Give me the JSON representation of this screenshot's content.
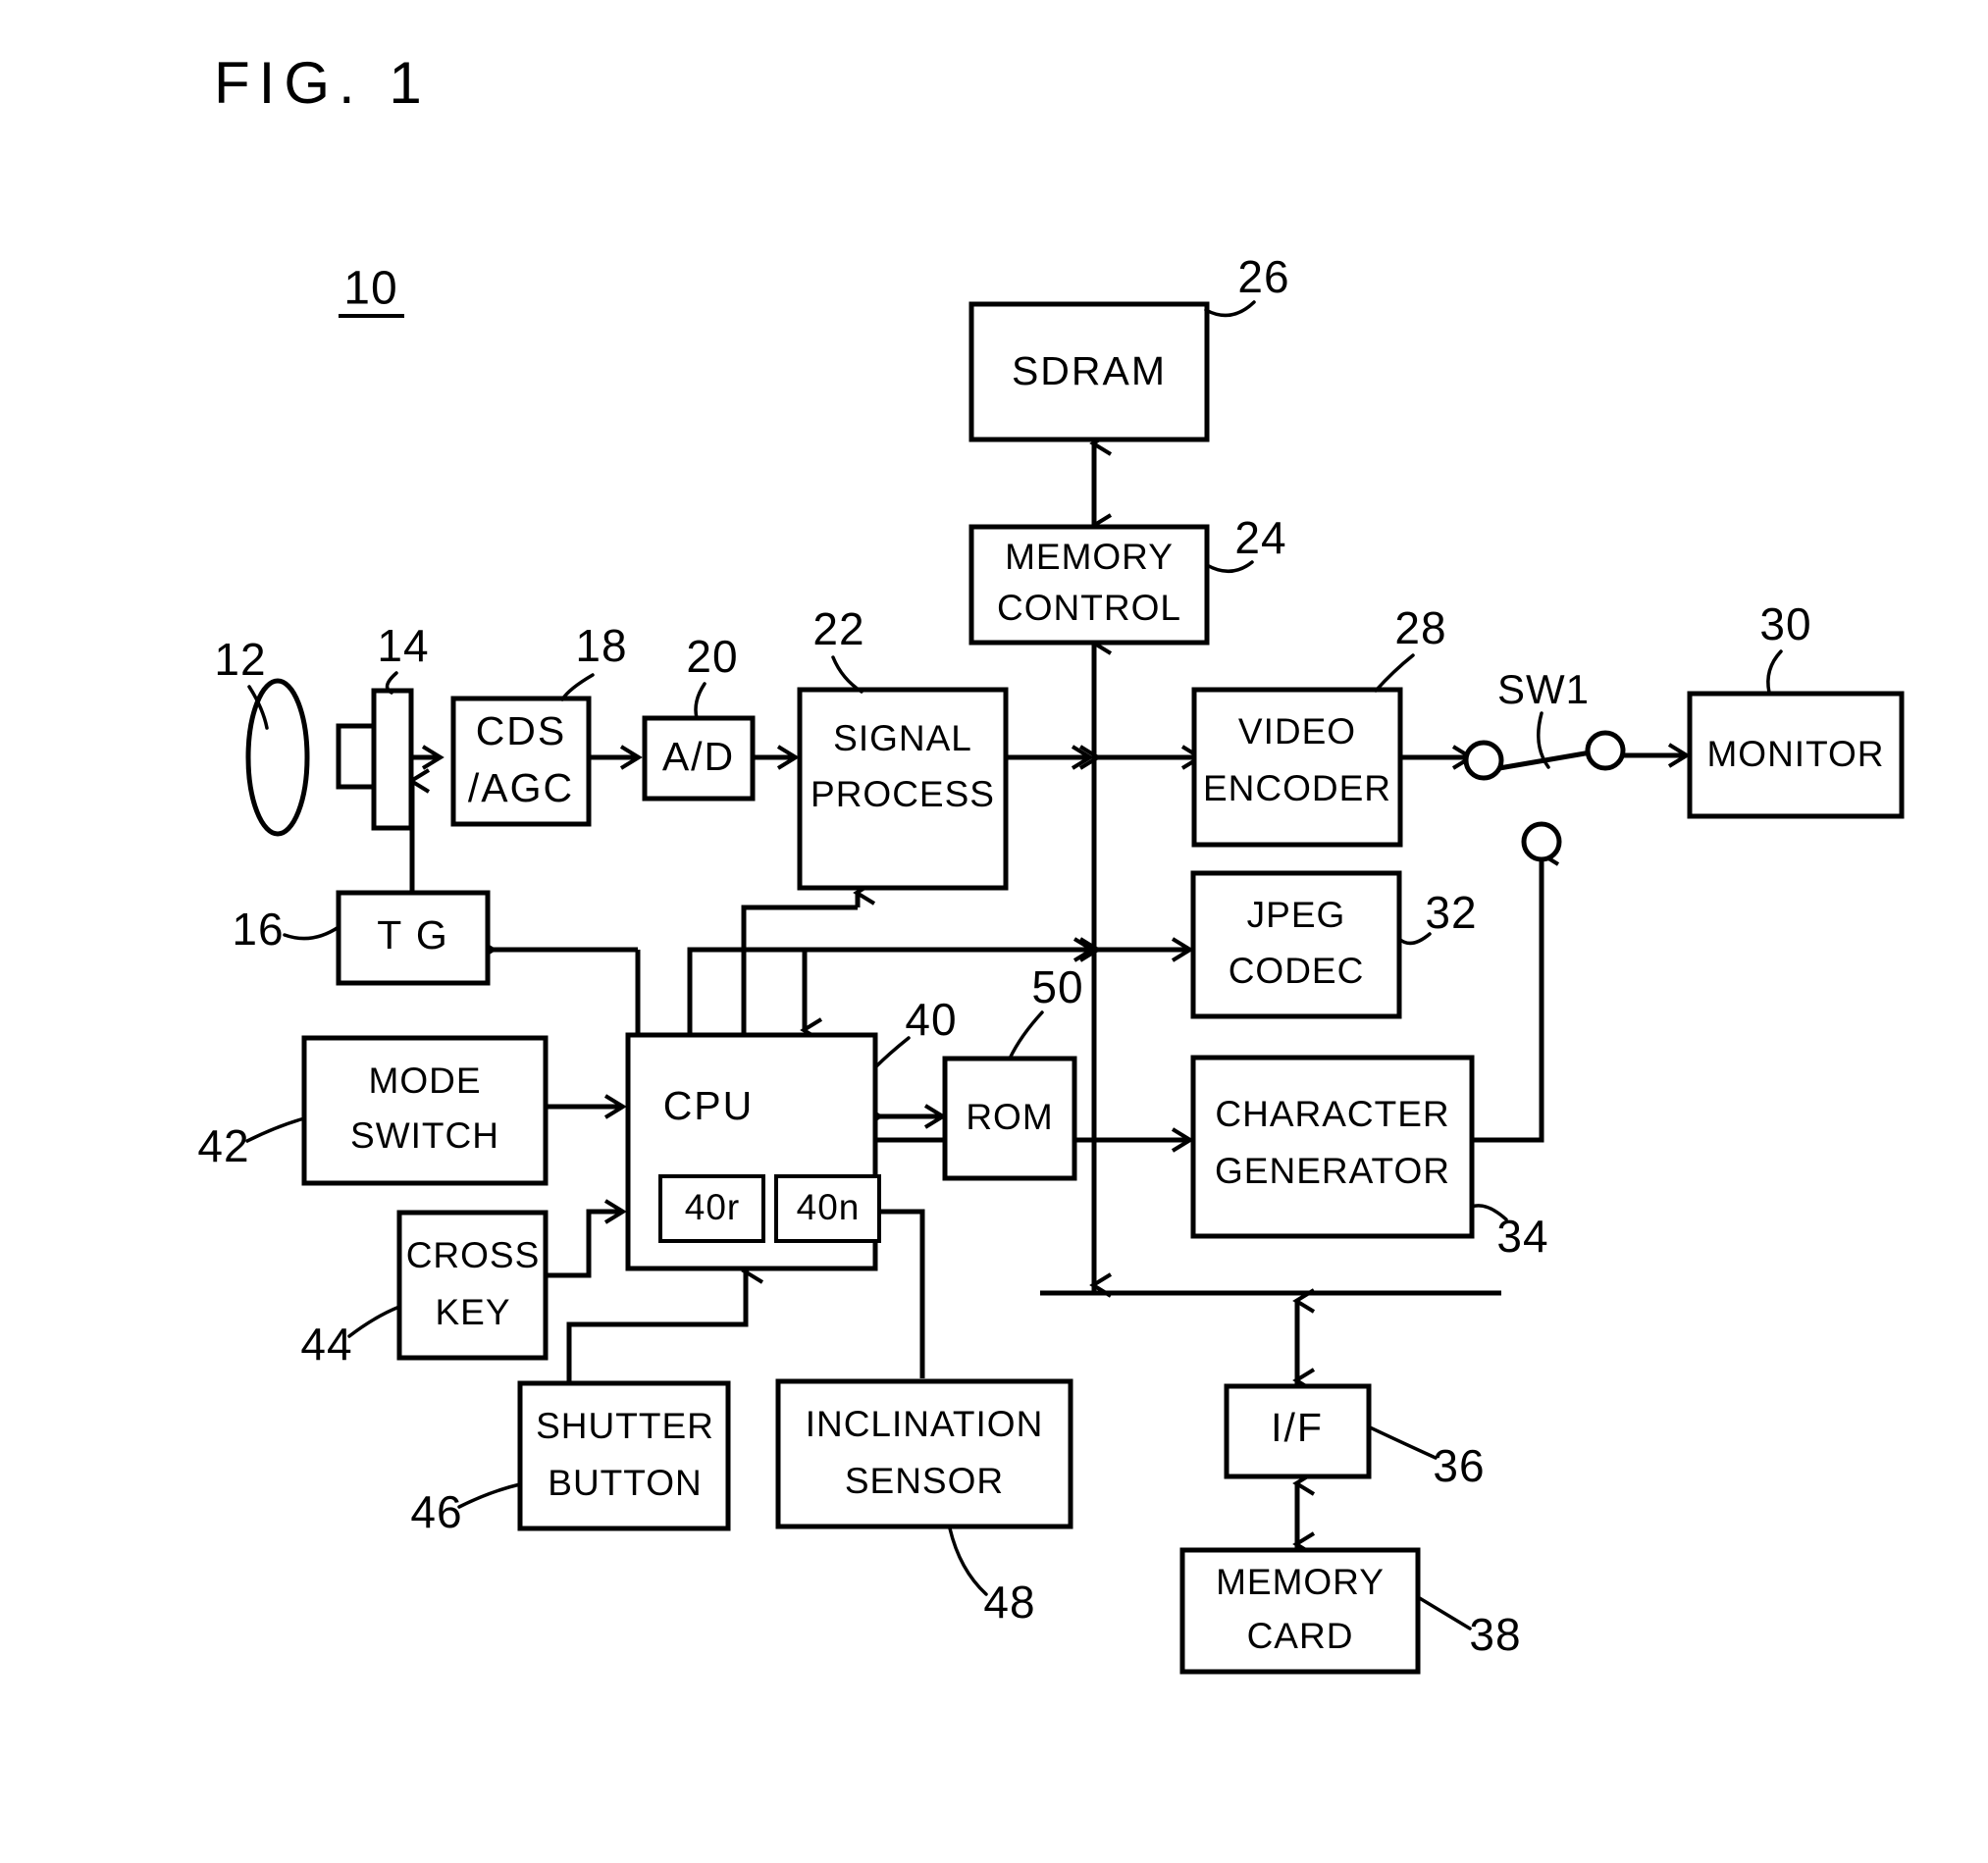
{
  "figure": {
    "title": "FIG.  1",
    "system_number": "10"
  },
  "blocks": [
    {
      "id": "lens",
      "label_lines": [
        "LENS"
      ],
      "ref": "12",
      "shape": "ellipse"
    },
    {
      "id": "imager",
      "label_lines": [],
      "ref": "14",
      "shape": "sensor"
    },
    {
      "id": "tg",
      "label_lines": [
        "T G"
      ],
      "ref": "16",
      "shape": "rect"
    },
    {
      "id": "cds_agc",
      "label_lines": [
        "CDS",
        "/AGC"
      ],
      "ref": "18",
      "shape": "rect"
    },
    {
      "id": "ad",
      "label_lines": [
        "A/D"
      ],
      "ref": "20",
      "shape": "rect"
    },
    {
      "id": "signal",
      "label_lines": [
        "SIGNAL",
        "PROCESS"
      ],
      "ref": "22",
      "shape": "rect"
    },
    {
      "id": "memctl",
      "label_lines": [
        "MEMORY",
        "CONTROL"
      ],
      "ref": "24",
      "shape": "rect"
    },
    {
      "id": "sdram",
      "label_lines": [
        "SDRAM"
      ],
      "ref": "26",
      "shape": "rect"
    },
    {
      "id": "vencoder",
      "label_lines": [
        "VIDEO",
        "ENCODER"
      ],
      "ref": "28",
      "shape": "rect"
    },
    {
      "id": "monitor",
      "label_lines": [
        "MONITOR"
      ],
      "ref": "30",
      "shape": "rect"
    },
    {
      "id": "jpeg",
      "label_lines": [
        "JPEG",
        "CODEC"
      ],
      "ref": "32",
      "shape": "rect"
    },
    {
      "id": "chargen",
      "label_lines": [
        "CHARACTER",
        "GENERATOR"
      ],
      "ref": "34",
      "shape": "rect"
    },
    {
      "id": "if",
      "label_lines": [
        "I/F"
      ],
      "ref": "36",
      "shape": "rect"
    },
    {
      "id": "memcard",
      "label_lines": [
        "MEMORY",
        "CARD"
      ],
      "ref": "38",
      "shape": "rect"
    },
    {
      "id": "cpu",
      "label_lines": [
        "CPU"
      ],
      "ref": "40",
      "shape": "rect"
    },
    {
      "id": "cpu_reg_r",
      "label_lines": [
        "40r"
      ],
      "ref": "",
      "shape": "rect"
    },
    {
      "id": "cpu_reg_n",
      "label_lines": [
        "40n"
      ],
      "ref": "",
      "shape": "rect"
    },
    {
      "id": "modesw",
      "label_lines": [
        "MODE",
        "SWITCH"
      ],
      "ref": "42",
      "shape": "rect"
    },
    {
      "id": "crosskey",
      "label_lines": [
        "CROSS",
        "KEY"
      ],
      "ref": "44",
      "shape": "rect"
    },
    {
      "id": "shutter",
      "label_lines": [
        "SHUTTER",
        "BUTTON"
      ],
      "ref": "46",
      "shape": "rect"
    },
    {
      "id": "inclin",
      "label_lines": [
        "INCLINATION",
        "SENSOR"
      ],
      "ref": "48",
      "shape": "rect"
    },
    {
      "id": "rom",
      "label_lines": [
        "ROM"
      ],
      "ref": "50",
      "shape": "rect"
    }
  ],
  "labels": {
    "sdram": "SDRAM",
    "memory_control_l1": "MEMORY",
    "memory_control_l2": "CONTROL",
    "cds_l1": "CDS",
    "cds_l2": "/AGC",
    "ad": "A/D",
    "signal_l1": "SIGNAL",
    "signal_l2": "PROCESS",
    "video_l1": "VIDEO",
    "video_l2": "ENCODER",
    "monitor": "MONITOR",
    "jpeg_l1": "JPEG",
    "jpeg_l2": "CODEC",
    "chargen_l1": "CHARACTER",
    "chargen_l2": "GENERATOR",
    "iface": "I/F",
    "memcard_l1": "MEMORY",
    "memcard_l2": "CARD",
    "tg": "T G",
    "cpu": "CPU",
    "cpu_reg_r": "40r",
    "cpu_reg_n": "40n",
    "rom": "ROM",
    "mode_l1": "MODE",
    "mode_l2": "SWITCH",
    "cross_l1": "CROSS",
    "cross_l2": "KEY",
    "shutter_l1": "SHUTTER",
    "shutter_l2": "BUTTON",
    "inclin_l1": "INCLINATION",
    "inclin_l2": "SENSOR",
    "sw1": "SW1"
  },
  "refs": {
    "r10": "10",
    "r12": "12",
    "r14": "14",
    "r16": "16",
    "r18": "18",
    "r20": "20",
    "r22": "22",
    "r24": "24",
    "r26": "26",
    "r28": "28",
    "r30": "30",
    "r32": "32",
    "r34": "34",
    "r36": "36",
    "r38": "38",
    "r40": "40",
    "r42": "42",
    "r44": "44",
    "r46": "46",
    "r48": "48",
    "r50": "50"
  },
  "colors": {
    "ink": "#000000",
    "paper": "#ffffff"
  }
}
